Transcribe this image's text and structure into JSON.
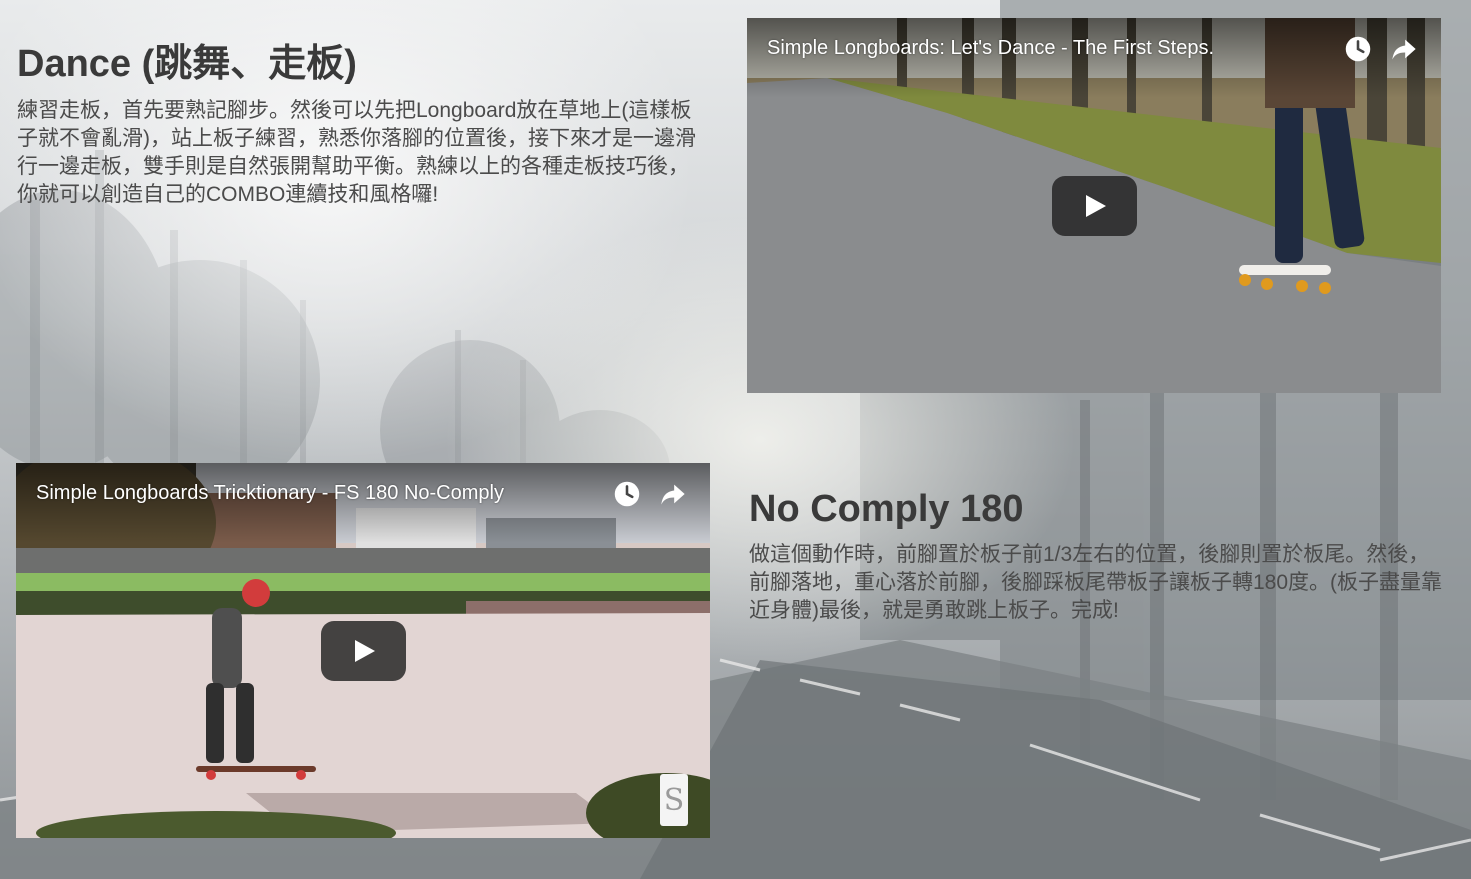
{
  "sections": {
    "dance": {
      "title": "Dance (跳舞、走板)",
      "text": "練習走板，首先要熟記腳步。然後可以先把Longboard放在草地上(這樣板子就不會亂滑)，站上板子練習，熟悉你落腳的位置後，接下來才是一邊滑行一邊走板，雙手則是自然張開幫助平衡。熟練以上的各種走板技巧後，你就可以創造自己的COMBO連續技和風格囉!",
      "video": {
        "title": "Simple Longboards: Let's Dance - The First Steps.",
        "watch_later_icon": "clock-icon",
        "share_icon": "share-arrow-icon",
        "play_icon": "play-icon"
      }
    },
    "nocomply": {
      "title": "No Comply 180",
      "text": "做這個動作時，前腳置於板子前1/3左右的位置，後腳則置於板尾。然後，前腳落地，重心落於前腳，後腳踩板尾帶板子讓板子轉180度。(板子盡量靠近身體)最後，就是勇敢跳上板子。完成!",
      "video": {
        "title": "Simple Longboards Tricktionary - FS 180 No-Comply",
        "watch_later_icon": "clock-icon",
        "share_icon": "share-arrow-icon",
        "play_icon": "play-icon",
        "logo_icon": "simple-longboards-logo-icon"
      }
    }
  },
  "colors": {
    "heading": "#3a3a3a",
    "body_text": "#4b4b4b",
    "video_title": "#ffffff",
    "play_button": "#212121"
  }
}
